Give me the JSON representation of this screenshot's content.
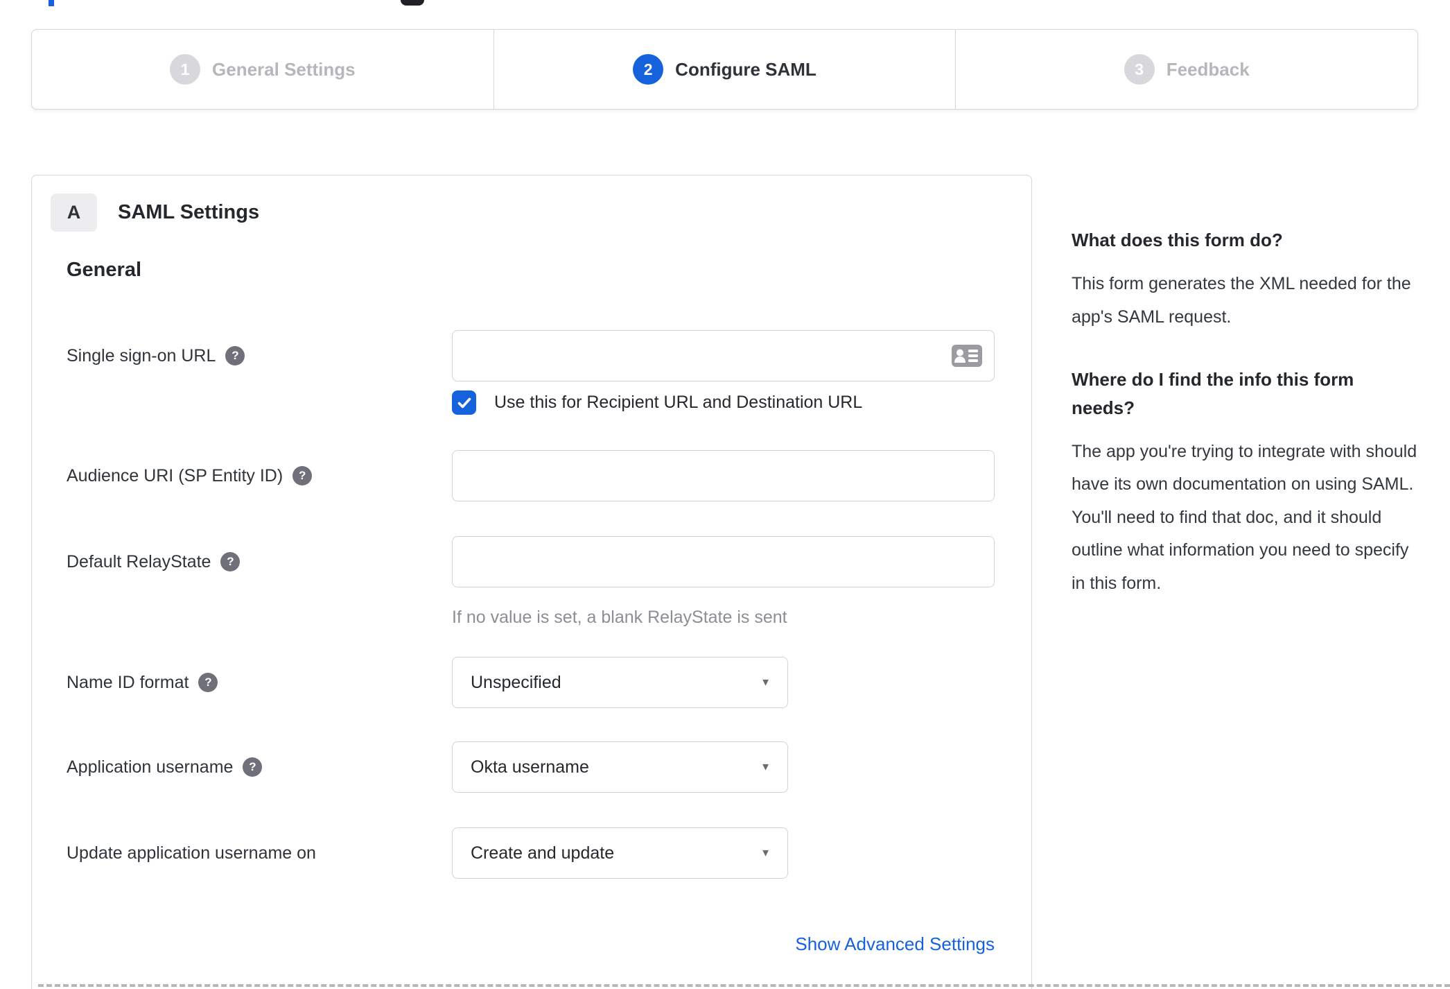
{
  "colors": {
    "accent_blue": "#1662dd",
    "inactive_circle_grey": "#d8d8dc",
    "inactive_text_grey": "#b6b6bb",
    "text_dark": "#24282d",
    "muted_text_grey": "#8d8d95",
    "border_grey": "#d6d6db",
    "help_icon_grey": "#70707a"
  },
  "stepper": {
    "active_step": 2,
    "steps": [
      {
        "number": "1",
        "label": "General Settings"
      },
      {
        "number": "2",
        "label": "Configure SAML"
      },
      {
        "number": "3",
        "label": "Feedback"
      }
    ]
  },
  "form": {
    "section_badge": "A",
    "section_title": "SAML Settings",
    "group_heading": "General",
    "fields": {
      "sso": {
        "label": "Single sign-on URL",
        "value": "",
        "checkbox_label": "Use this for Recipient URL and Destination URL",
        "checkbox_checked": true
      },
      "audience": {
        "label": "Audience URI (SP Entity ID)",
        "value": ""
      },
      "relay": {
        "label": "Default RelayState",
        "value": "",
        "hint": "If no value is set, a blank RelayState is sent"
      },
      "name_id": {
        "label": "Name ID format",
        "value": "Unspecified"
      },
      "app_username": {
        "label": "Application username",
        "value": "Okta username"
      },
      "update_username": {
        "label": "Update application username on",
        "value": "Create and update"
      }
    },
    "advanced_link": "Show Advanced Settings"
  },
  "icons": {
    "help_glyph": "?",
    "caret_glyph": "▼",
    "contact_card": "contact-card-icon",
    "checkmark": "checkmark-icon"
  },
  "sidebar": {
    "heading1": "What does this form do?",
    "body1": "This form generates the XML needed for the app's SAML request.",
    "heading2": "Where do I find the info this form needs?",
    "body2": "The app you're trying to integrate with should have its own documentation on using SAML. You'll need to find that doc, and it should outline what information you need to specify in this form."
  }
}
